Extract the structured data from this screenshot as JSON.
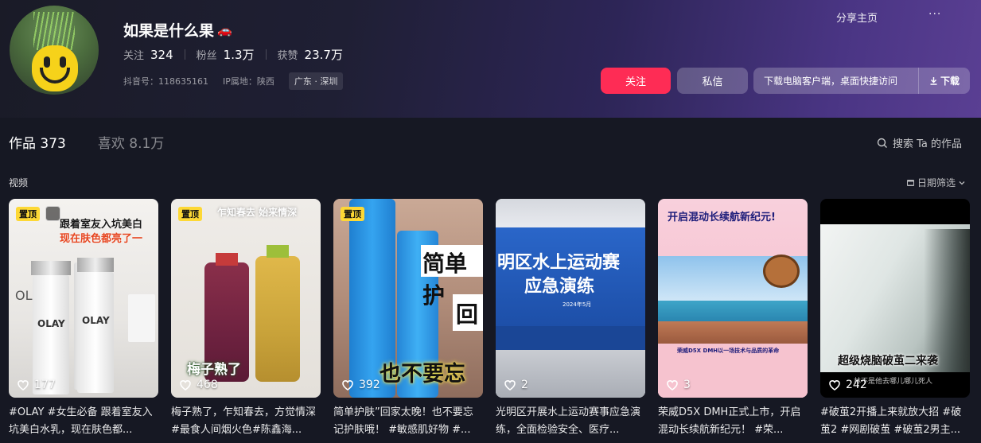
{
  "profile": {
    "name": "如果是什么果",
    "name_emoji": "🚗",
    "stats": [
      {
        "label": "关注",
        "value": "324"
      },
      {
        "label": "粉丝",
        "value": "1.3万"
      },
      {
        "label": "获赞",
        "value": "23.7万"
      }
    ],
    "douyin_id": "抖音号：118635161",
    "ip_location": "IP属地：陕西",
    "region_tag": "广东 · 深圳"
  },
  "top_actions": {
    "share": "分享主页",
    "more": "···"
  },
  "buttons": {
    "follow": "关注",
    "message": "私信",
    "download_hint": "下载电脑客户端，桌面快捷访问",
    "download": "下载"
  },
  "tabs": [
    {
      "label": "作品 373",
      "active": true
    },
    {
      "label": "喜欢 8.1万",
      "active": false
    }
  ],
  "search": {
    "label": "搜索 Ta 的作品"
  },
  "section": {
    "label": "视频",
    "date_filter": "日期筛选"
  },
  "pin_label": "置顶",
  "videos": [
    {
      "likes": "177",
      "pinned": true,
      "overlay": [
        "跟着室友入坑美白",
        "现在肤色都亮了一"
      ],
      "caption": "#OLAY #女生必备 跟着室友入坑美白水乳，现在肤色都..."
    },
    {
      "likes": "468",
      "pinned": true,
      "overlay": [
        "乍知春去 始来情深",
        "梅子熟了"
      ],
      "caption": "梅子熟了，乍知春去，方觉情深#最食人间烟火色#陈鑫海..."
    },
    {
      "likes": "392",
      "pinned": true,
      "overlay": [
        "简单护",
        "回",
        "也不要忘"
      ],
      "caption": "简单护肤”回家太晚！也不要忘记护肤哦！ #敏感肌好物 #..."
    },
    {
      "likes": "2",
      "pinned": false,
      "overlay": [
        "明区水上运动赛",
        "应急演练",
        "2024年5月"
      ],
      "caption": "光明区开展水上运动赛事应急演练，全面检验安全、医疗..."
    },
    {
      "likes": "3",
      "pinned": false,
      "overlay": [
        "开启混动长续航新纪元!",
        "荣威D5X DMH以一场技术与品质的革命"
      ],
      "caption": "荣威D5X DMH正式上市，开启混动长续航新纪元！ #荣..."
    },
    {
      "likes": "242",
      "pinned": false,
      "overlay": [
        "超级烧脑破茧二来袭",
        "林不是他去哪儿哪儿死人"
      ],
      "caption": "#破茧2开播上来就放大招 #破茧2 #网剧破茧 #破茧2男主..."
    }
  ]
}
